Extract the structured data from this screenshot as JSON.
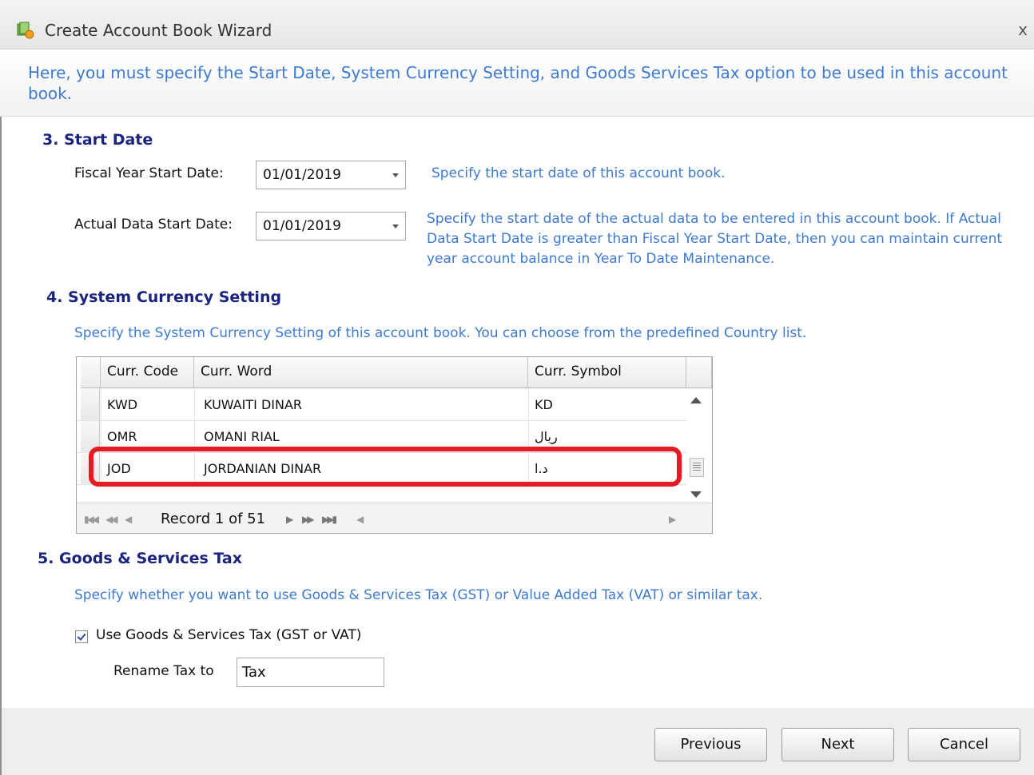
{
  "window": {
    "title": "Create Account Book Wizard",
    "close_glyph": "x"
  },
  "banner": {
    "text": "Here, you must specify the Start Date, System Currency Setting, and Goods  Services Tax option to be used in this account book."
  },
  "start_date": {
    "title": "3. Start Date",
    "fiscal_label": "Fiscal Year Start Date:",
    "fiscal_value": "01/01/2019",
    "fiscal_hint": "Specify the start date of this account book.",
    "actual_label": "Actual Data Start Date:",
    "actual_value": "01/01/2019",
    "actual_hint": "Specify the start date of the actual data to be entered in this account book. If Actual Data Start Date is greater than Fiscal Year Start Date, then you can maintain current year account balance in Year To Date Maintenance."
  },
  "currency": {
    "title": "4. System Currency Setting",
    "hint": "Specify the System Currency Setting of this account book. You can choose from the predefined Country list.",
    "columns": [
      "Curr. Code",
      "Curr. Word",
      "Curr. Symbol"
    ],
    "rows": [
      {
        "code": "KWD",
        "word": "KUWAITI DINAR",
        "symbol": "KD"
      },
      {
        "code": "OMR",
        "word": "OMANI RIAL",
        "symbol": "ريال"
      },
      {
        "code": "JOD",
        "word": "JORDANIAN DINAR",
        "symbol": "د.ا"
      }
    ],
    "selected_code": "JOD",
    "record_text": "Record 1 of 51"
  },
  "tax": {
    "title": "5. Goods & Services Tax",
    "hint": "Specify whether you want to use Goods & Services Tax (GST) or Value Added Tax (VAT) or similar tax.",
    "checkbox_label": "Use Goods & Services Tax (GST or VAT)",
    "checked": true,
    "rename_label": "Rename Tax to",
    "rename_value": "Tax"
  },
  "buttons": {
    "previous": "Previous",
    "next": "Next",
    "cancel": "Cancel"
  },
  "colors": {
    "hint_blue": "#3d7ad0",
    "section_navy": "#1a237e",
    "highlight_red": "#e31c23"
  }
}
